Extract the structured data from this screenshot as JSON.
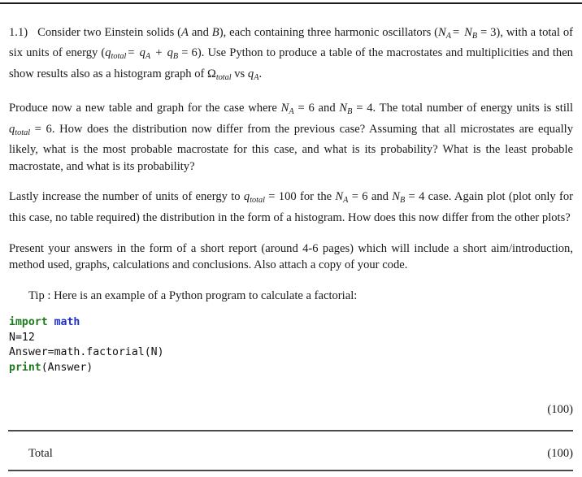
{
  "document": {
    "question_label": "1.1)",
    "paragraphs": {
      "p1": {
        "seg1": "Consider two Einstein solids (",
        "var_A": "A",
        "seg2": " and ",
        "var_B": "B",
        "seg3": "), each containing three harmonic oscillators (",
        "math_NA": "N",
        "sub_A": "A",
        "eq1": "=",
        "math_NB": "N",
        "sub_B": "B",
        "eq2": "= 3), with a total of six units of energy (",
        "math_q": "q",
        "sub_total": "total",
        "eq3": "=",
        "math_qA": "q",
        "sub_A2": "A",
        "plus": "+",
        "math_qB": "q",
        "sub_B2": "B",
        "eq4": "= 6). Use Python to produce a table of the macrostates and multiplicities and then show results also as a histogram graph of ",
        "omega": "Ω",
        "sub_total2": "total",
        "vs": " vs ",
        "math_qA2": "q",
        "sub_A3": "A",
        "period": "."
      },
      "p2": {
        "seg1": "Produce now a new table and graph for the case where ",
        "NA": "N",
        "subA": "A",
        "eqA": "= 6 and ",
        "NB": "N",
        "subB": "B",
        "eqB": "= 4. The total number of energy units is still ",
        "q": "q",
        "subtotal": "total",
        "eqq": "= 6. How does the distribution now differ from the previous case? Assuming that all microstates are equally likely, what is the most probable macrostate for this case, and what is its probability? What is the least probable macrostate, and what is its probability?"
      },
      "p3": {
        "seg1": "Lastly increase the number of units of energy to ",
        "q": "q",
        "subtotal": "total",
        "eqq": "= 100 for the ",
        "NA": "N",
        "subA": "A",
        "eqA": "= 6 and ",
        "NB": "N",
        "subB": "B",
        "eqB": "= 4 case. Again plot (plot only for this case, no table required) the distribution in the form of a histogram. How does this now differ from the other plots?"
      },
      "p4": "Present your answers in the form of a short report (around 4-6 pages) which will include a short aim/introduction, method used, graphs, calculations and conclusions. Also attach a copy of your code."
    },
    "tip_line": "Tip : Here is an example of a Python program to calculate a factorial:",
    "code": {
      "line1_kw": "import",
      "line1_mod": "math",
      "line2": "N=12",
      "line3": "Answer=math.factorial(N)",
      "line4_fn": "print",
      "line4_args": "(Answer)"
    },
    "marks": {
      "question_marks": "(100)",
      "total_label": "Total",
      "total_marks": "(100)"
    },
    "colors": {
      "text": "#1a1a1a",
      "keyword_green": "#1f7a1f",
      "module_blue": "#2030c8",
      "rule_gray": "#4a4a4a",
      "background": "#ffffff"
    }
  }
}
